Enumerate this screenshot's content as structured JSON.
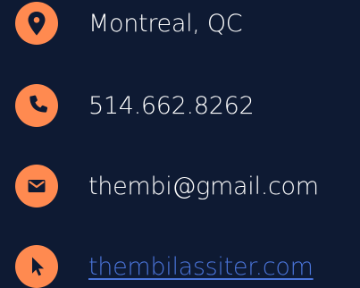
{
  "contacts": {
    "location": {
      "text": "Montreal, QC",
      "icon": "map-pin-icon"
    },
    "phone": {
      "text": "514.662.8262",
      "icon": "phone-icon"
    },
    "email": {
      "text": "thembi@gmail.com",
      "icon": "envelope-icon"
    },
    "website": {
      "text": "thembilassiter.com",
      "icon": "cursor-icon"
    }
  },
  "colors": {
    "background": "#0e1a33",
    "accent": "#ff8a50",
    "text": "#ffffff",
    "link": "#4a74d9"
  }
}
